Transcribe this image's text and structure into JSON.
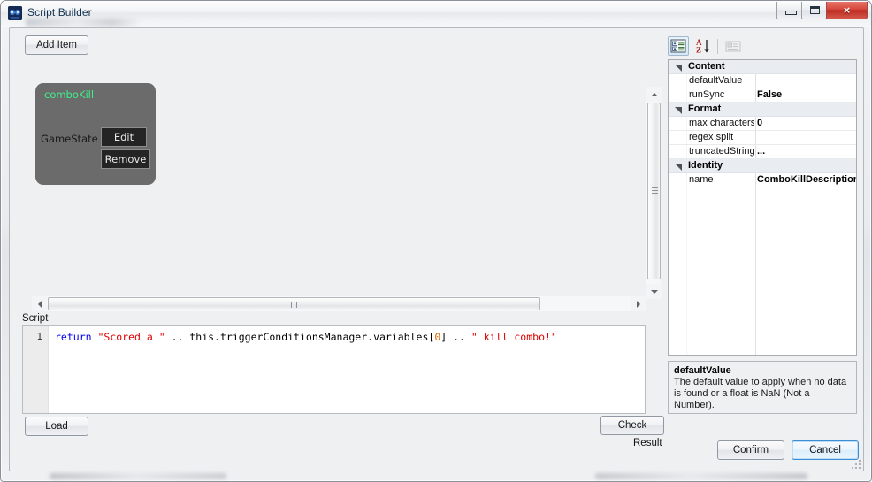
{
  "window": {
    "title": "Script Builder",
    "icon": "app-icon",
    "controls": {
      "minimize": "minimize-icon",
      "maximize": "maximize-icon",
      "close": "×"
    }
  },
  "toolbar": {
    "add_item_label": "Add Item"
  },
  "canvas": {
    "node": {
      "title": "comboKill",
      "field_label": "GameState",
      "edit_label": "Edit",
      "remove_label": "Remove",
      "bg_color": "#6b6b6b",
      "title_color": "#3ef08a"
    },
    "vscrollbar": {
      "up": "scroll-up",
      "down": "scroll-down"
    },
    "hscrollbar": {
      "left": "scroll-left",
      "right": "scroll-right"
    }
  },
  "script": {
    "label": "Script",
    "line_number": "1",
    "tokens": [
      {
        "t": "return",
        "c": "tok-kw"
      },
      {
        "t": " ",
        "c": "tok-op"
      },
      {
        "t": "\"Scored a \"",
        "c": "tok-str"
      },
      {
        "t": " .. ",
        "c": "tok-op"
      },
      {
        "t": "this.triggerConditionsManager.variables",
        "c": "tok-op"
      },
      {
        "t": "[",
        "c": "tok-op"
      },
      {
        "t": "0",
        "c": "tok-num"
      },
      {
        "t": "]",
        "c": "tok-op"
      },
      {
        "t": " .. ",
        "c": "tok-op"
      },
      {
        "t": "\" kill combo!\"",
        "c": "tok-str"
      }
    ],
    "plain": "return \"Scored a \" .. this.triggerConditionsManager.variables[0] .. \" kill combo!\""
  },
  "property_grid": {
    "toolbar": {
      "categorized": "categorized-view-icon",
      "alphabetical": "alphabetical-sort-icon",
      "property_pages": "property-pages-icon"
    },
    "rows": [
      {
        "kind": "category",
        "name": "Content"
      },
      {
        "kind": "property",
        "name": "defaultValue",
        "value": ""
      },
      {
        "kind": "property",
        "name": "runSync",
        "value": "False"
      },
      {
        "kind": "category",
        "name": "Format"
      },
      {
        "kind": "property",
        "name": "max characters",
        "value": "0"
      },
      {
        "kind": "property",
        "name": "regex split",
        "value": ""
      },
      {
        "kind": "property",
        "name": "truncatedString",
        "value": "..."
      },
      {
        "kind": "category",
        "name": "Identity"
      },
      {
        "kind": "property",
        "name": "name",
        "value": "ComboKillDescription"
      }
    ],
    "description": {
      "title": "defaultValue",
      "body": "The default value to apply when no data is found or a float is NaN (Not a Number)."
    }
  },
  "footer": {
    "load_label": "Load",
    "check_label": "Check",
    "result_label": "Result",
    "confirm_label": "Confirm",
    "cancel_label": "Cancel",
    "focus_color": "#3c8ed4"
  }
}
